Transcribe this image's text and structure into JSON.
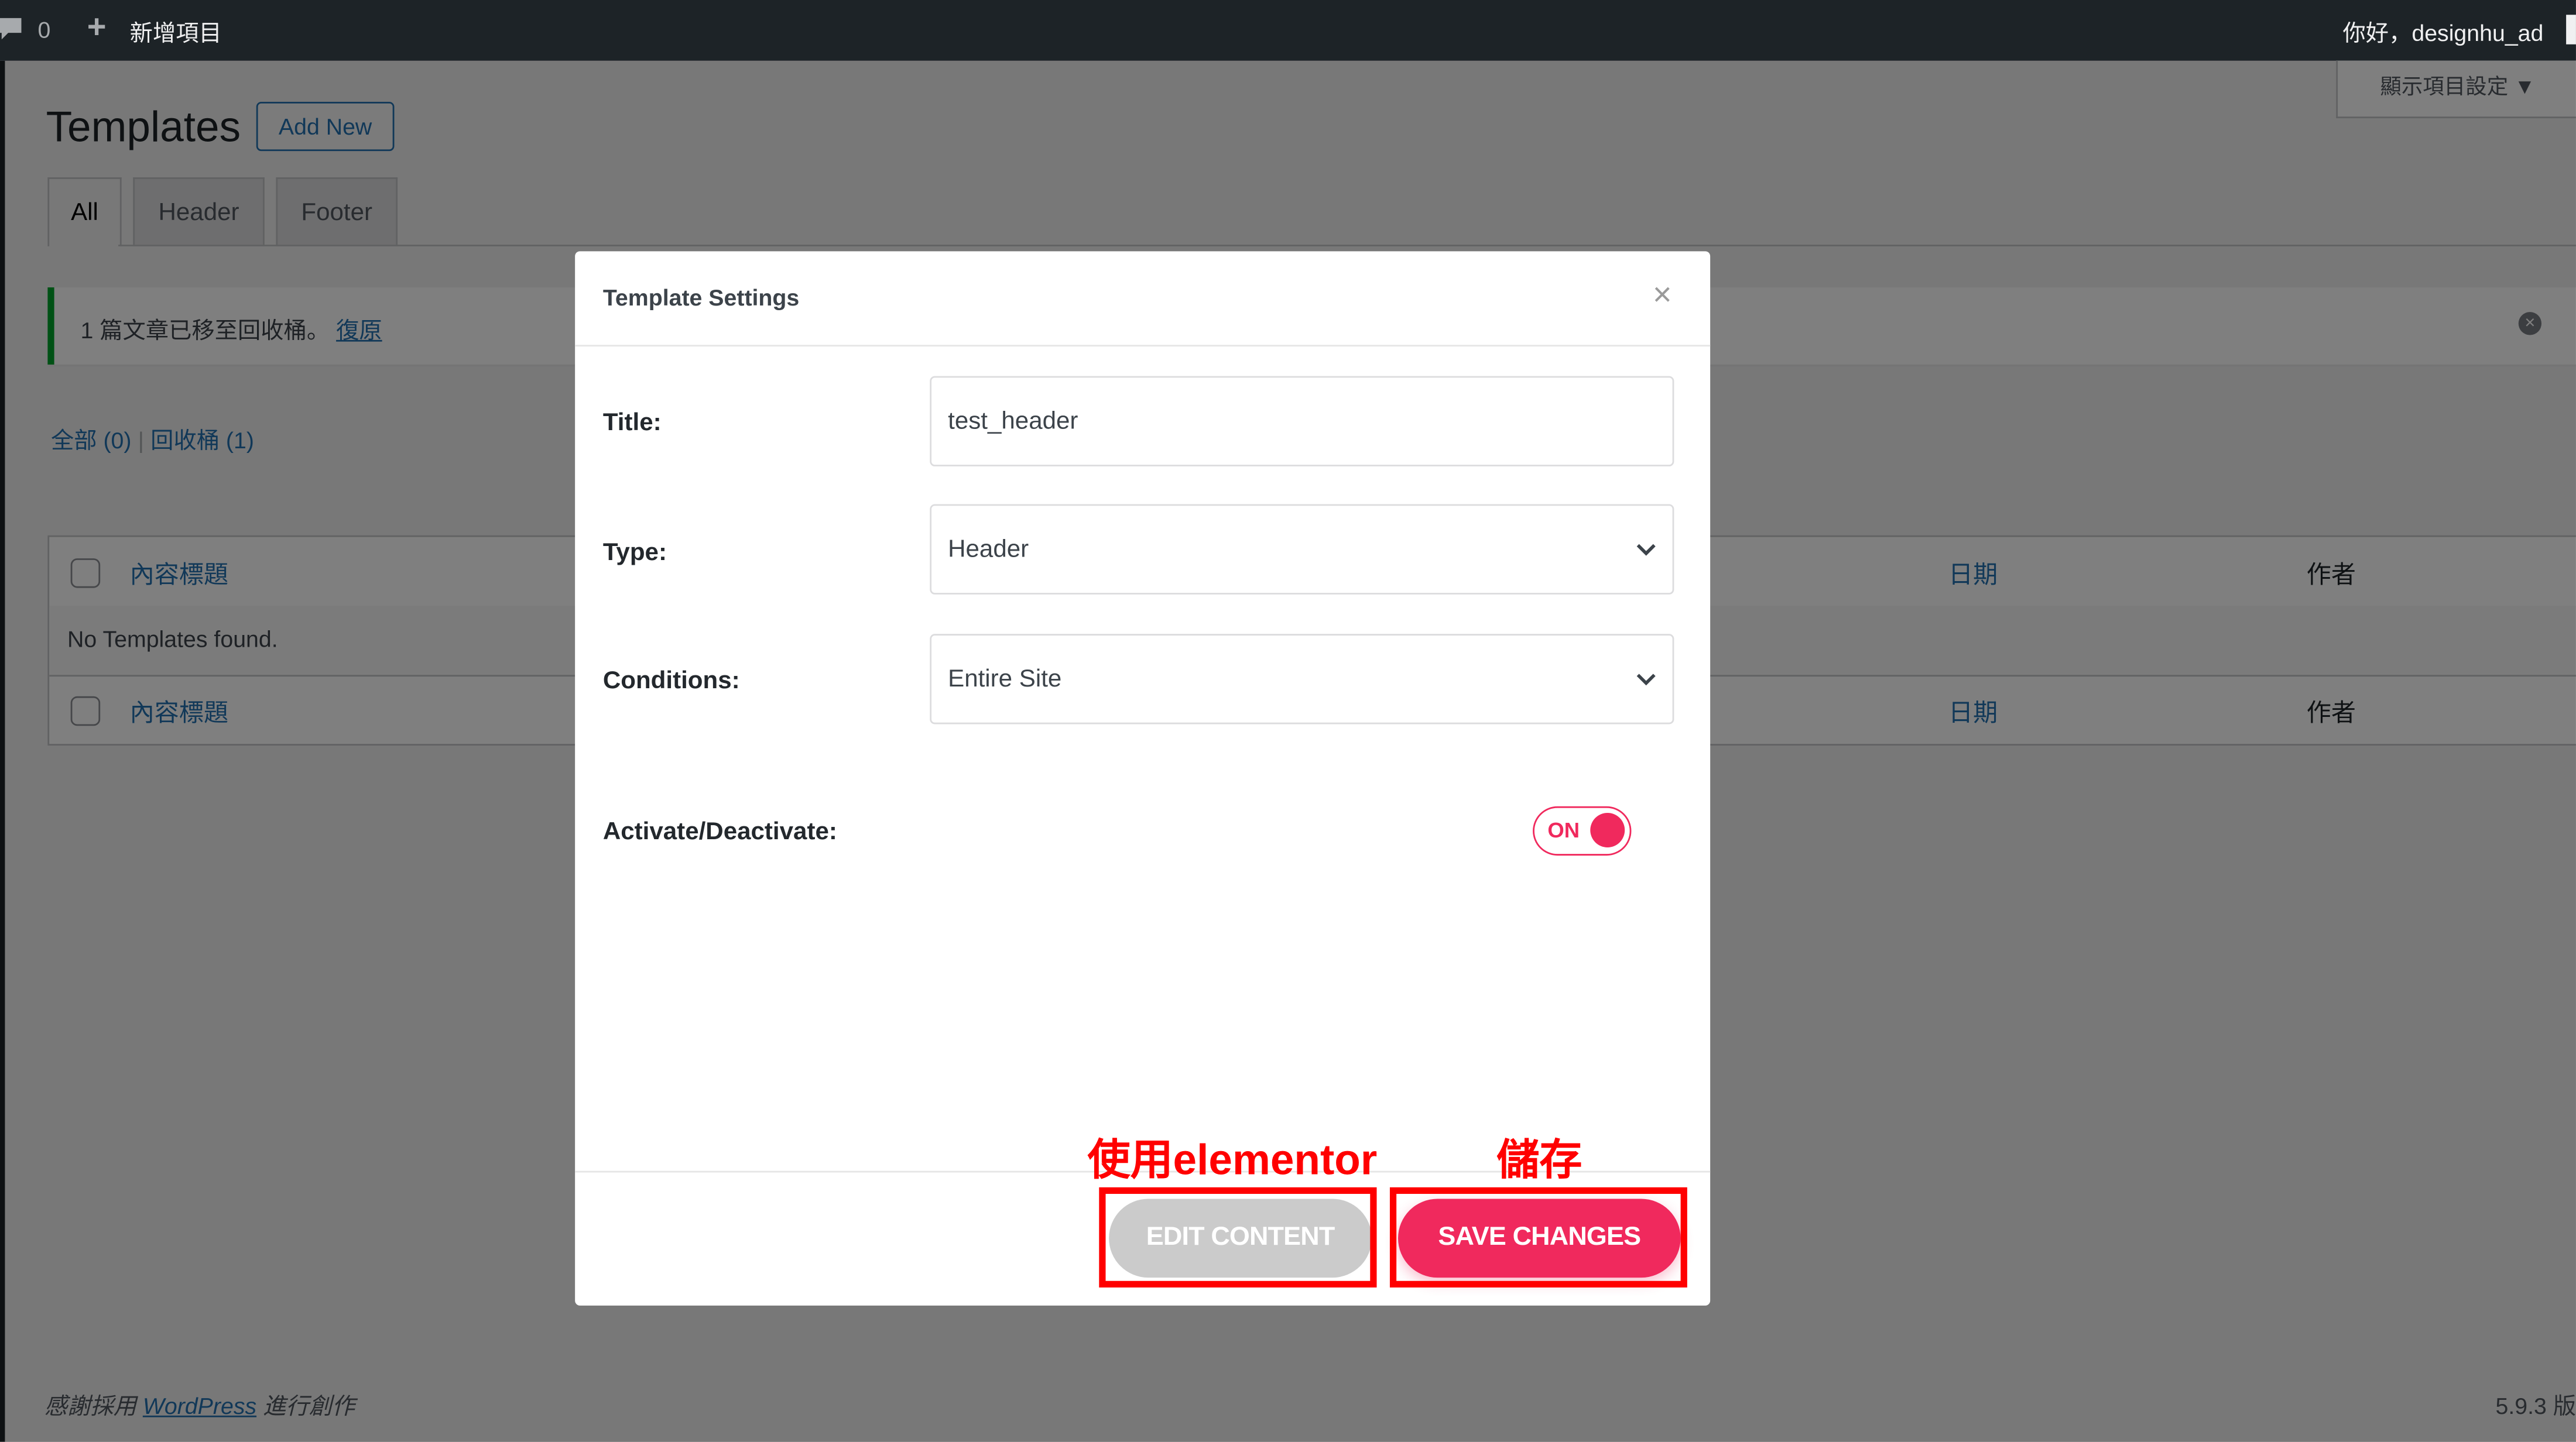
{
  "admin_bar": {
    "comments_count": "0",
    "new_item": "新增項目",
    "greeting": "你好，designhu_ad"
  },
  "screen_options": "顯示項目設定 ▼",
  "page": {
    "title": "Templates",
    "add_new": "Add New"
  },
  "tabs": [
    {
      "label": "All",
      "active": true
    },
    {
      "label": "Header"
    },
    {
      "label": "Footer"
    }
  ],
  "notice": {
    "text": "1 篇文章已移至回收桶。",
    "undo": "復原"
  },
  "views": {
    "all": "全部 (0)",
    "separator": "|",
    "trash": "回收桶 (1)"
  },
  "table": {
    "columns": {
      "title": "內容標題",
      "date": "日期",
      "author": "作者"
    },
    "empty": "No Templates found."
  },
  "footer": {
    "thanks_pre": "感謝採用 ",
    "wordpress": "WordPress",
    "thanks_post": " 進行創作",
    "version": "5.9.3 版"
  },
  "modal": {
    "title": "Template Settings",
    "close": "×",
    "fields": {
      "title_label": "Title:",
      "title_value": "test_header",
      "type_label": "Type:",
      "type_value": "Header",
      "conditions_label": "Conditions:",
      "conditions_value": "Entire Site",
      "activate_label": "Activate/Deactivate:",
      "toggle_text": "ON",
      "toggle_on": true
    },
    "edit_button": "EDIT CONTENT",
    "save_button": "SAVE CHANGES"
  },
  "annotations": {
    "edit": "使用elementor",
    "save": "儲存"
  },
  "colors": {
    "accent": "#f0295d",
    "annotation": "#ff0000",
    "link": "#2271b1",
    "notice": "#00a32a"
  }
}
